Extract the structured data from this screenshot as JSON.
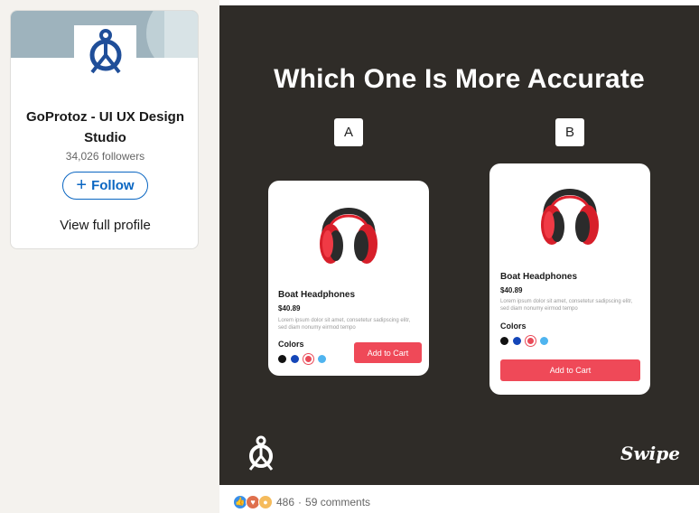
{
  "profile": {
    "company_name": "GoProtoz - UI UX Design Studio",
    "followers": "34,026 followers",
    "follow_icon": "plus-icon",
    "follow_label": "Follow",
    "view_profile_label": "View full profile",
    "brand_color": "#1f4e99"
  },
  "post": {
    "headline": "Which One Is More Accurate",
    "option_a": "A",
    "option_b": "B",
    "signature": "Swipe",
    "cards": [
      {
        "product_name": "Boat Headphones",
        "price": "$40.89",
        "description": "Lorem ipsum dolor sit amet, consetetur sadipscing elitr, sed diam nonumy eirmod tempo",
        "colors_label": "Colors",
        "swatches": [
          "#111111",
          "#1446b8",
          "#e94a58",
          "#4fb4ef"
        ],
        "cart_label": "Add to Cart"
      },
      {
        "product_name": "Boat Headphones",
        "price": "$40.89",
        "description": "Lorem ipsum dolor sit amet, consetetur sadipscing elitr, sed diam nonumy eirmod tempo",
        "colors_label": "Colors",
        "swatches": [
          "#111111",
          "#1446b8",
          "#e94a58",
          "#4fb4ef"
        ],
        "cart_label": "Add to Cart"
      }
    ],
    "accent_color": "#ef4958",
    "panel_color": "#2f2c28"
  },
  "social": {
    "reaction_icons": [
      "like-icon",
      "love-icon",
      "insightful-icon"
    ],
    "reaction_count": "486",
    "separator": "·",
    "comments": "59 comments"
  }
}
